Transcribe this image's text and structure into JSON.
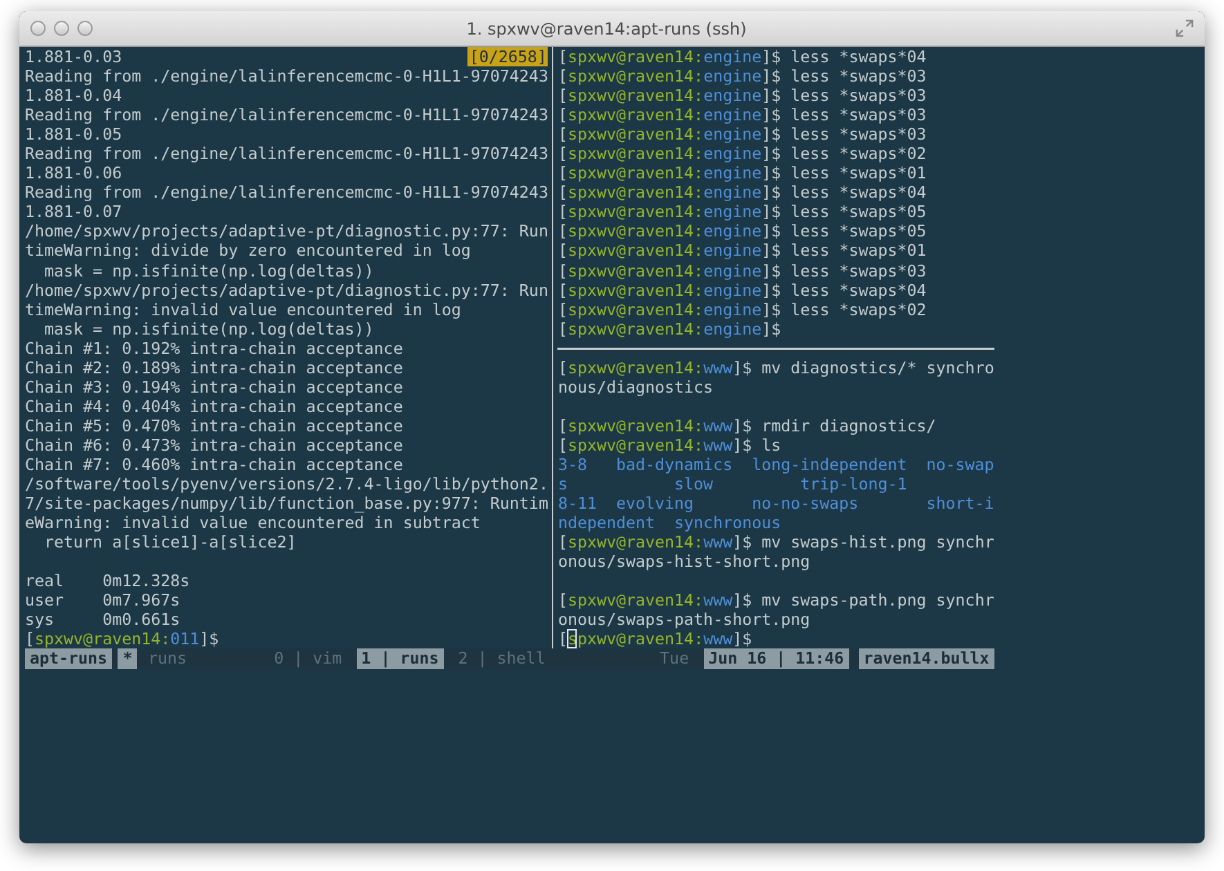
{
  "window": {
    "title": "1. spxwv@raven14:apt-runs (ssh)"
  },
  "left_pane": {
    "position_badge": "[0/2658]",
    "lines": [
      {
        "kind": "text",
        "segments": [
          {
            "kind": "plain",
            "text": "1.881-0.03"
          }
        ]
      },
      {
        "kind": "text",
        "segments": [
          {
            "kind": "plain",
            "text": "Reading from ./engine/lalinferencemcmc-0-H1L1-97074243"
          }
        ]
      },
      {
        "kind": "text",
        "segments": [
          {
            "kind": "plain",
            "text": "1.881-0.04"
          }
        ]
      },
      {
        "kind": "text",
        "segments": [
          {
            "kind": "plain",
            "text": "Reading from ./engine/lalinferencemcmc-0-H1L1-97074243"
          }
        ]
      },
      {
        "kind": "text",
        "segments": [
          {
            "kind": "plain",
            "text": "1.881-0.05"
          }
        ]
      },
      {
        "kind": "text",
        "segments": [
          {
            "kind": "plain",
            "text": "Reading from ./engine/lalinferencemcmc-0-H1L1-97074243"
          }
        ]
      },
      {
        "kind": "text",
        "segments": [
          {
            "kind": "plain",
            "text": "1.881-0.06"
          }
        ]
      },
      {
        "kind": "text",
        "segments": [
          {
            "kind": "plain",
            "text": "Reading from ./engine/lalinferencemcmc-0-H1L1-97074243"
          }
        ]
      },
      {
        "kind": "text",
        "segments": [
          {
            "kind": "plain",
            "text": "1.881-0.07"
          }
        ]
      },
      {
        "kind": "text",
        "segments": [
          {
            "kind": "plain",
            "text": "/home/spxwv/projects/adaptive-pt/diagnostic.py:77: Run"
          }
        ]
      },
      {
        "kind": "text",
        "segments": [
          {
            "kind": "plain",
            "text": "timeWarning: divide by zero encountered in log"
          }
        ]
      },
      {
        "kind": "text",
        "segments": [
          {
            "kind": "plain",
            "text": "  mask = np.isfinite(np.log(deltas))"
          }
        ]
      },
      {
        "kind": "text",
        "segments": [
          {
            "kind": "plain",
            "text": "/home/spxwv/projects/adaptive-pt/diagnostic.py:77: Run"
          }
        ]
      },
      {
        "kind": "text",
        "segments": [
          {
            "kind": "plain",
            "text": "timeWarning: invalid value encountered in log"
          }
        ]
      },
      {
        "kind": "text",
        "segments": [
          {
            "kind": "plain",
            "text": "  mask = np.isfinite(np.log(deltas))"
          }
        ]
      },
      {
        "kind": "text",
        "segments": [
          {
            "kind": "plain",
            "text": "Chain #1: 0.192% intra-chain acceptance"
          }
        ]
      },
      {
        "kind": "text",
        "segments": [
          {
            "kind": "plain",
            "text": "Chain #2: 0.189% intra-chain acceptance"
          }
        ]
      },
      {
        "kind": "text",
        "segments": [
          {
            "kind": "plain",
            "text": "Chain #3: 0.194% intra-chain acceptance"
          }
        ]
      },
      {
        "kind": "text",
        "segments": [
          {
            "kind": "plain",
            "text": "Chain #4: 0.404% intra-chain acceptance"
          }
        ]
      },
      {
        "kind": "text",
        "segments": [
          {
            "kind": "plain",
            "text": "Chain #5: 0.470% intra-chain acceptance"
          }
        ]
      },
      {
        "kind": "text",
        "segments": [
          {
            "kind": "plain",
            "text": "Chain #6: 0.473% intra-chain acceptance"
          }
        ]
      },
      {
        "kind": "text",
        "segments": [
          {
            "kind": "plain",
            "text": "Chain #7: 0.460% intra-chain acceptance"
          }
        ]
      },
      {
        "kind": "text",
        "segments": [
          {
            "kind": "plain",
            "text": "/software/tools/pyenv/versions/2.7.4-ligo/lib/python2."
          }
        ]
      },
      {
        "kind": "text",
        "segments": [
          {
            "kind": "plain",
            "text": "7/site-packages/numpy/lib/function_base.py:977: Runtim"
          }
        ]
      },
      {
        "kind": "text",
        "segments": [
          {
            "kind": "plain",
            "text": "eWarning: invalid value encountered in subtract"
          }
        ]
      },
      {
        "kind": "text",
        "segments": [
          {
            "kind": "plain",
            "text": "  return a[slice1]-a[slice2]"
          }
        ]
      },
      {
        "kind": "blank"
      },
      {
        "kind": "text",
        "segments": [
          {
            "kind": "plain",
            "text": "real    0m12.328s"
          }
        ]
      },
      {
        "kind": "text",
        "segments": [
          {
            "kind": "plain",
            "text": "user    0m7.967s"
          }
        ]
      },
      {
        "kind": "text",
        "segments": [
          {
            "kind": "plain",
            "text": "sys     0m0.661s"
          }
        ]
      },
      {
        "kind": "text",
        "segments": [
          {
            "kind": "plain",
            "text": "["
          },
          {
            "kind": "user",
            "text": "spxwv@raven14:"
          },
          {
            "kind": "dir",
            "text": "011"
          },
          {
            "kind": "plain",
            "text": "]$"
          }
        ]
      }
    ]
  },
  "right_top_pane": {
    "lines": [
      {
        "kind": "text",
        "segments": [
          {
            "kind": "plain",
            "text": "["
          },
          {
            "kind": "user",
            "text": "spxwv@raven14:"
          },
          {
            "kind": "dir",
            "text": "engine"
          },
          {
            "kind": "plain",
            "text": "]$ less *swaps*04"
          }
        ]
      },
      {
        "kind": "text",
        "segments": [
          {
            "kind": "plain",
            "text": "["
          },
          {
            "kind": "user",
            "text": "spxwv@raven14:"
          },
          {
            "kind": "dir",
            "text": "engine"
          },
          {
            "kind": "plain",
            "text": "]$ less *swaps*03"
          }
        ]
      },
      {
        "kind": "text",
        "segments": [
          {
            "kind": "plain",
            "text": "["
          },
          {
            "kind": "user",
            "text": "spxwv@raven14:"
          },
          {
            "kind": "dir",
            "text": "engine"
          },
          {
            "kind": "plain",
            "text": "]$ less *swaps*03"
          }
        ]
      },
      {
        "kind": "text",
        "segments": [
          {
            "kind": "plain",
            "text": "["
          },
          {
            "kind": "user",
            "text": "spxwv@raven14:"
          },
          {
            "kind": "dir",
            "text": "engine"
          },
          {
            "kind": "plain",
            "text": "]$ less *swaps*03"
          }
        ]
      },
      {
        "kind": "text",
        "segments": [
          {
            "kind": "plain",
            "text": "["
          },
          {
            "kind": "user",
            "text": "spxwv@raven14:"
          },
          {
            "kind": "dir",
            "text": "engine"
          },
          {
            "kind": "plain",
            "text": "]$ less *swaps*03"
          }
        ]
      },
      {
        "kind": "text",
        "segments": [
          {
            "kind": "plain",
            "text": "["
          },
          {
            "kind": "user",
            "text": "spxwv@raven14:"
          },
          {
            "kind": "dir",
            "text": "engine"
          },
          {
            "kind": "plain",
            "text": "]$ less *swaps*02"
          }
        ]
      },
      {
        "kind": "text",
        "segments": [
          {
            "kind": "plain",
            "text": "["
          },
          {
            "kind": "user",
            "text": "spxwv@raven14:"
          },
          {
            "kind": "dir",
            "text": "engine"
          },
          {
            "kind": "plain",
            "text": "]$ less *swaps*01"
          }
        ]
      },
      {
        "kind": "text",
        "segments": [
          {
            "kind": "plain",
            "text": "["
          },
          {
            "kind": "user",
            "text": "spxwv@raven14:"
          },
          {
            "kind": "dir",
            "text": "engine"
          },
          {
            "kind": "plain",
            "text": "]$ less *swaps*04"
          }
        ]
      },
      {
        "kind": "text",
        "segments": [
          {
            "kind": "plain",
            "text": "["
          },
          {
            "kind": "user",
            "text": "spxwv@raven14:"
          },
          {
            "kind": "dir",
            "text": "engine"
          },
          {
            "kind": "plain",
            "text": "]$ less *swaps*05"
          }
        ]
      },
      {
        "kind": "text",
        "segments": [
          {
            "kind": "plain",
            "text": "["
          },
          {
            "kind": "user",
            "text": "spxwv@raven14:"
          },
          {
            "kind": "dir",
            "text": "engine"
          },
          {
            "kind": "plain",
            "text": "]$ less *swaps*05"
          }
        ]
      },
      {
        "kind": "text",
        "segments": [
          {
            "kind": "plain",
            "text": "["
          },
          {
            "kind": "user",
            "text": "spxwv@raven14:"
          },
          {
            "kind": "dir",
            "text": "engine"
          },
          {
            "kind": "plain",
            "text": "]$ less *swaps*01"
          }
        ]
      },
      {
        "kind": "text",
        "segments": [
          {
            "kind": "plain",
            "text": "["
          },
          {
            "kind": "user",
            "text": "spxwv@raven14:"
          },
          {
            "kind": "dir",
            "text": "engine"
          },
          {
            "kind": "plain",
            "text": "]$ less *swaps*03"
          }
        ]
      },
      {
        "kind": "text",
        "segments": [
          {
            "kind": "plain",
            "text": "["
          },
          {
            "kind": "user",
            "text": "spxwv@raven14:"
          },
          {
            "kind": "dir",
            "text": "engine"
          },
          {
            "kind": "plain",
            "text": "]$ less *swaps*04"
          }
        ]
      },
      {
        "kind": "text",
        "segments": [
          {
            "kind": "plain",
            "text": "["
          },
          {
            "kind": "user",
            "text": "spxwv@raven14:"
          },
          {
            "kind": "dir",
            "text": "engine"
          },
          {
            "kind": "plain",
            "text": "]$ less *swaps*02"
          }
        ]
      },
      {
        "kind": "text",
        "segments": [
          {
            "kind": "plain",
            "text": "["
          },
          {
            "kind": "user",
            "text": "spxwv@raven14:"
          },
          {
            "kind": "dir",
            "text": "engine"
          },
          {
            "kind": "plain",
            "text": "]$"
          }
        ]
      }
    ]
  },
  "right_bottom_pane": {
    "lines": [
      {
        "kind": "text",
        "segments": [
          {
            "kind": "plain",
            "text": "["
          },
          {
            "kind": "user",
            "text": "spxwv@raven14:"
          },
          {
            "kind": "dir",
            "text": "www"
          },
          {
            "kind": "plain",
            "text": "]$ mv diagnostics/* synchro"
          }
        ]
      },
      {
        "kind": "text",
        "segments": [
          {
            "kind": "plain",
            "text": "nous/diagnostics"
          }
        ]
      },
      {
        "kind": "blank"
      },
      {
        "kind": "text",
        "segments": [
          {
            "kind": "plain",
            "text": "["
          },
          {
            "kind": "user",
            "text": "spxwv@raven14:"
          },
          {
            "kind": "dir",
            "text": "www"
          },
          {
            "kind": "plain",
            "text": "]$ rmdir diagnostics/"
          }
        ]
      },
      {
        "kind": "text",
        "segments": [
          {
            "kind": "plain",
            "text": "["
          },
          {
            "kind": "user",
            "text": "spxwv@raven14:"
          },
          {
            "kind": "dir",
            "text": "www"
          },
          {
            "kind": "plain",
            "text": "]$ ls"
          }
        ]
      },
      {
        "kind": "text",
        "segments": [
          {
            "kind": "dir",
            "text": "3-8   bad-dynamics  long-independent  no-swap"
          }
        ]
      },
      {
        "kind": "text",
        "segments": [
          {
            "kind": "dir",
            "text": "s           slow         trip-long-1"
          }
        ]
      },
      {
        "kind": "text",
        "segments": [
          {
            "kind": "dir",
            "text": "8-11  evolving      no-no-swaps       short-i"
          }
        ]
      },
      {
        "kind": "text",
        "segments": [
          {
            "kind": "dir",
            "text": "ndependent  synchronous"
          }
        ]
      },
      {
        "kind": "text",
        "segments": [
          {
            "kind": "plain",
            "text": "["
          },
          {
            "kind": "user",
            "text": "spxwv@raven14:"
          },
          {
            "kind": "dir",
            "text": "www"
          },
          {
            "kind": "plain",
            "text": "]$ mv swaps-hist.png synchr"
          }
        ]
      },
      {
        "kind": "text",
        "segments": [
          {
            "kind": "plain",
            "text": "onous/swaps-hist-short.png"
          }
        ]
      },
      {
        "kind": "blank"
      },
      {
        "kind": "text",
        "segments": [
          {
            "kind": "plain",
            "text": "["
          },
          {
            "kind": "user",
            "text": "spxwv@raven14:"
          },
          {
            "kind": "dir",
            "text": "www"
          },
          {
            "kind": "plain",
            "text": "]$ mv swaps-path.png synchr"
          }
        ]
      },
      {
        "kind": "text",
        "segments": [
          {
            "kind": "plain",
            "text": "onous/swaps-path-short.png"
          }
        ]
      },
      {
        "kind": "text",
        "segments": [
          {
            "kind": "plain",
            "text": "["
          },
          {
            "kind": "user",
            "text": "s",
            "cursor": true
          },
          {
            "kind": "user",
            "text": "pxwv@raven14:"
          },
          {
            "kind": "dir",
            "text": "www"
          },
          {
            "kind": "plain",
            "text": "]$"
          }
        ]
      }
    ]
  },
  "status_bar": {
    "left": [
      {
        "kind": "highlight",
        "text": "apt-runs"
      },
      {
        "kind": "highlight",
        "text": "*"
      },
      {
        "kind": "dim",
        "text": "runs"
      }
    ],
    "windows": [
      {
        "label": "0 | vim",
        "selected": false
      },
      {
        "label": "1 | runs",
        "selected": true
      },
      {
        "label": "2 | shell",
        "selected": false
      }
    ],
    "right": [
      {
        "kind": "dim",
        "text": "Tue"
      },
      {
        "kind": "highlight",
        "text": "Jun 16 | 11:46"
      },
      {
        "kind": "highlight",
        "text": "raven14.bullx"
      }
    ]
  }
}
